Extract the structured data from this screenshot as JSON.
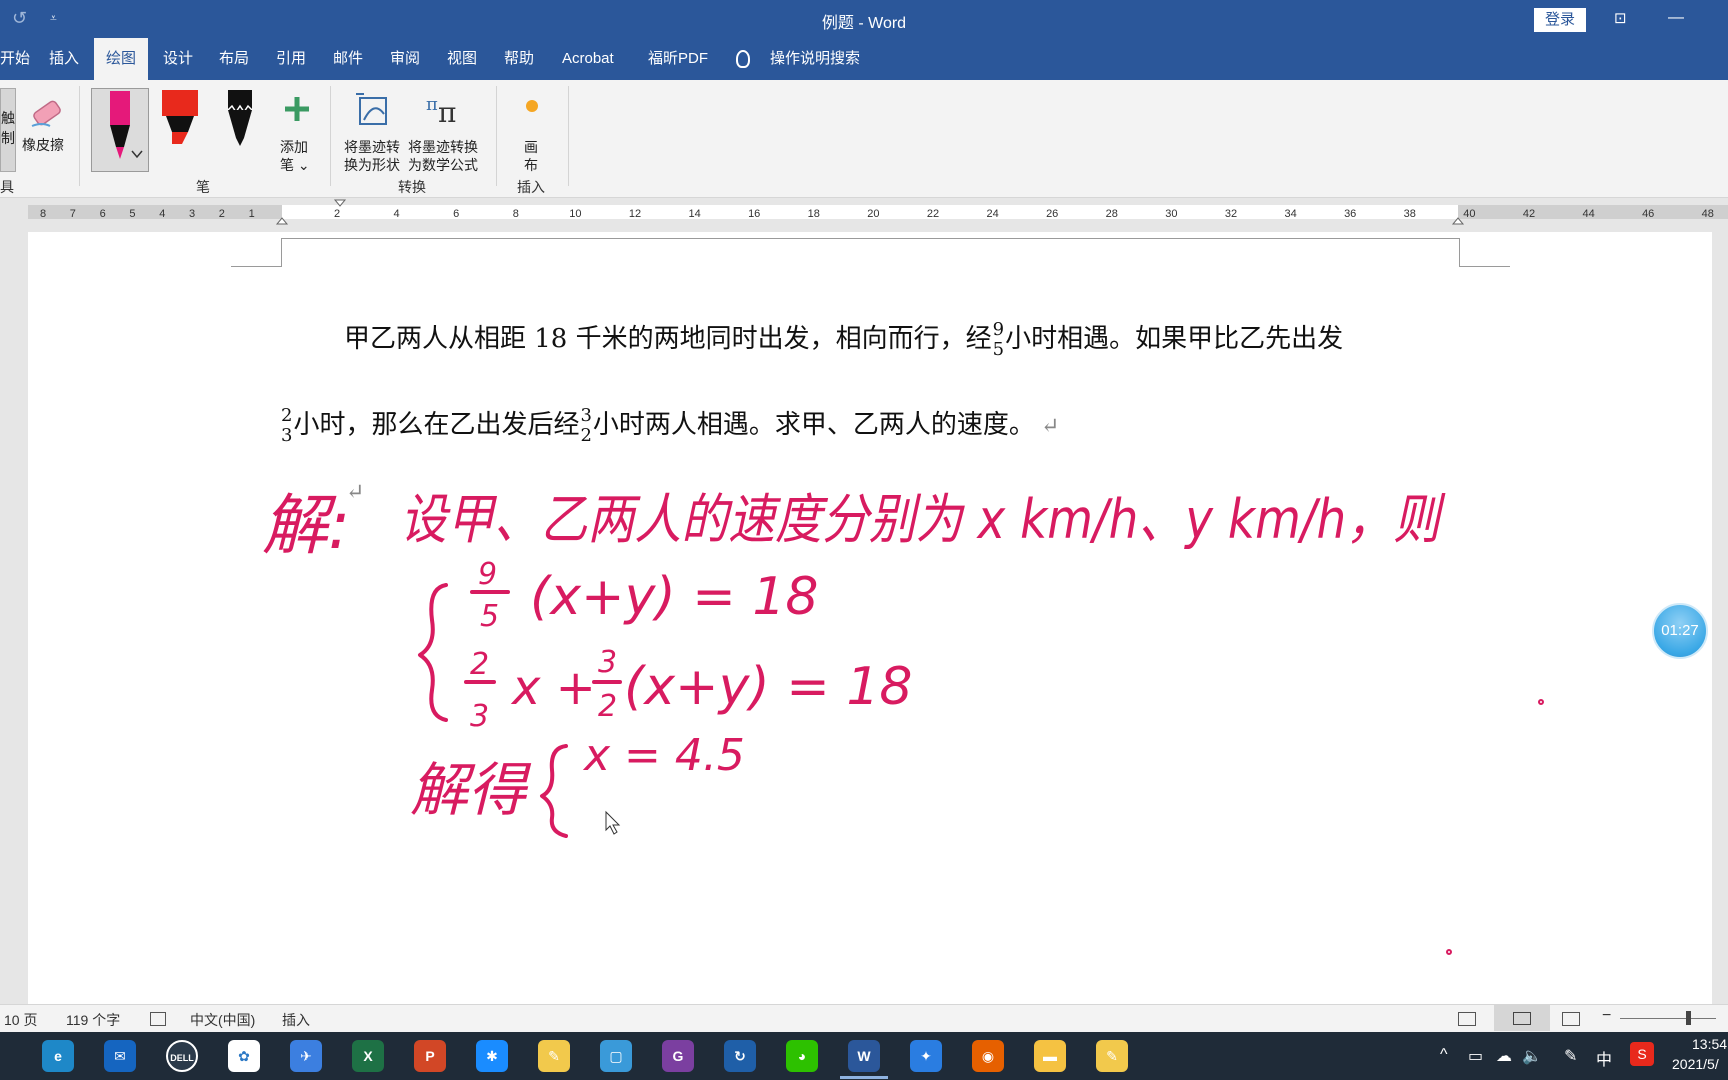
{
  "window": {
    "title": "例题  -  Word",
    "signin_label": "登录",
    "undo_icon": "undo-icon",
    "qa_more_glyph": "⩡",
    "ribbon_display_glyph": "⊡",
    "minimize_glyph": "—"
  },
  "tabs": [
    {
      "label": "开始",
      "active": false
    },
    {
      "label": "插入",
      "active": false
    },
    {
      "label": "绘图",
      "active": true
    },
    {
      "label": "设计",
      "active": false
    },
    {
      "label": "布局",
      "active": false
    },
    {
      "label": "引用",
      "active": false
    },
    {
      "label": "邮件",
      "active": false
    },
    {
      "label": "审阅",
      "active": false
    },
    {
      "label": "视图",
      "active": false
    },
    {
      "label": "帮助",
      "active": false
    },
    {
      "label": "Acrobat",
      "active": false
    },
    {
      "label": "福昕PDF",
      "active": false
    }
  ],
  "tell_me": {
    "label": "操作说明搜索",
    "icon": "lightbulb-icon"
  },
  "ribbon": {
    "tools_group_label": "具",
    "touch_draw_label_1": "触",
    "touch_draw_label_2": "制",
    "eraser_label": "橡皮擦",
    "pens_group_label": "笔",
    "add_pen_label_1": "添加",
    "add_pen_label_2": "笔 ⌄",
    "convert_group_label": "转换",
    "ink_to_shape_label_1": "将墨迹转",
    "ink_to_shape_label_2": "换为形状",
    "ink_to_math_label_1": "将墨迹转换",
    "ink_to_math_label_2": "为数学公式",
    "insert_group_label": "插入",
    "canvas_label_1": "画",
    "canvas_label_2": "布",
    "pen_colors": {
      "pink": "#e5197a",
      "red": "#e8291c",
      "black": "#111111"
    }
  },
  "ruler": {
    "left_numbers": [
      "8",
      "7",
      "6",
      "5",
      "4",
      "3",
      "2",
      "1"
    ],
    "right_numbers": [
      "2",
      "4",
      "6",
      "8",
      "10",
      "12",
      "14",
      "16",
      "18",
      "20",
      "22",
      "24",
      "26",
      "28",
      "30",
      "32",
      "34",
      "36",
      "38",
      "40",
      "42",
      "44",
      "46",
      "48"
    ]
  },
  "document": {
    "para1_text_a": "甲乙两人从相距 18 千米的两地同时出发，相向而行，经",
    "para1_frac": {
      "num": "9",
      "den": "5"
    },
    "para1_text_b": "小时相遇。如果甲比乙先出发",
    "para2_frac1": {
      "num": "2",
      "den": "3"
    },
    "para2_text_a": "小时，那么在乙出发后经",
    "para2_frac2": {
      "num": "3",
      "den": "2"
    },
    "para2_text_b": "小时两人相遇。求甲、乙两人的速度。",
    "pilcrow": "↵",
    "ink_color": "#d81b60",
    "ink_text": {
      "solve_label": "解:",
      "intro": "设甲、乙两人的速度分别为 x km/h、y km/h，则",
      "eq1_frac": {
        "num": "9",
        "den": "5"
      },
      "eq1_text": "(x+y) = 18",
      "eq2_frac1": {
        "num": "2",
        "den": "3"
      },
      "eq2_mid": "x +",
      "eq2_frac2": {
        "num": "3",
        "den": "2"
      },
      "eq2_text": "(x+y) = 18",
      "solution_label": "解得",
      "solution_x": "x = 4.5"
    }
  },
  "timer": {
    "label": "01:27"
  },
  "statusbar": {
    "page": "10 页",
    "words": "119 个字",
    "proofing_icon": "proofing-icon",
    "language": "中文(中国)",
    "mode": "插入",
    "zoom_minus": "−"
  },
  "taskbar": {
    "apps": [
      {
        "name": "edge",
        "glyph": "e",
        "color": "#1e88c8"
      },
      {
        "name": "mail",
        "glyph": "✉",
        "color": "#1565c0"
      },
      {
        "name": "dell",
        "glyph": "DELL",
        "color": "#2b3a4a"
      },
      {
        "name": "photos",
        "glyph": "✿",
        "color": "#ffffff"
      },
      {
        "name": "feishu",
        "glyph": "✈",
        "color": "#3c7fe0"
      },
      {
        "name": "excel",
        "glyph": "X",
        "color": "#1e7145"
      },
      {
        "name": "powerpoint",
        "glyph": "P",
        "color": "#d24726"
      },
      {
        "name": "dingtalk",
        "glyph": "✱",
        "color": "#1a8cff"
      },
      {
        "name": "notes",
        "glyph": "✎",
        "color": "#f2c94c"
      },
      {
        "name": "reader",
        "glyph": "▢",
        "color": "#3a9ad9"
      },
      {
        "name": "foxit-pdf",
        "glyph": "G",
        "color": "#7b3fa0"
      },
      {
        "name": "sync",
        "glyph": "↻",
        "color": "#1f5fa8"
      },
      {
        "name": "wechat",
        "glyph": "◕",
        "color": "#2dc100"
      },
      {
        "name": "word",
        "glyph": "W",
        "color": "#2b579a"
      },
      {
        "name": "kuaishou",
        "glyph": "✦",
        "color": "#2a7de1"
      },
      {
        "name": "firefox",
        "glyph": "◉",
        "color": "#e66000"
      },
      {
        "name": "explorer",
        "glyph": "▬",
        "color": "#f5c242"
      },
      {
        "name": "notes2",
        "glyph": "✎",
        "color": "#f2c94c"
      }
    ],
    "tray_glyphs": [
      "^",
      "▭",
      "☁",
      "🔈",
      "✎"
    ],
    "ime": "中",
    "time": "13:54",
    "date": "2021/5/"
  }
}
